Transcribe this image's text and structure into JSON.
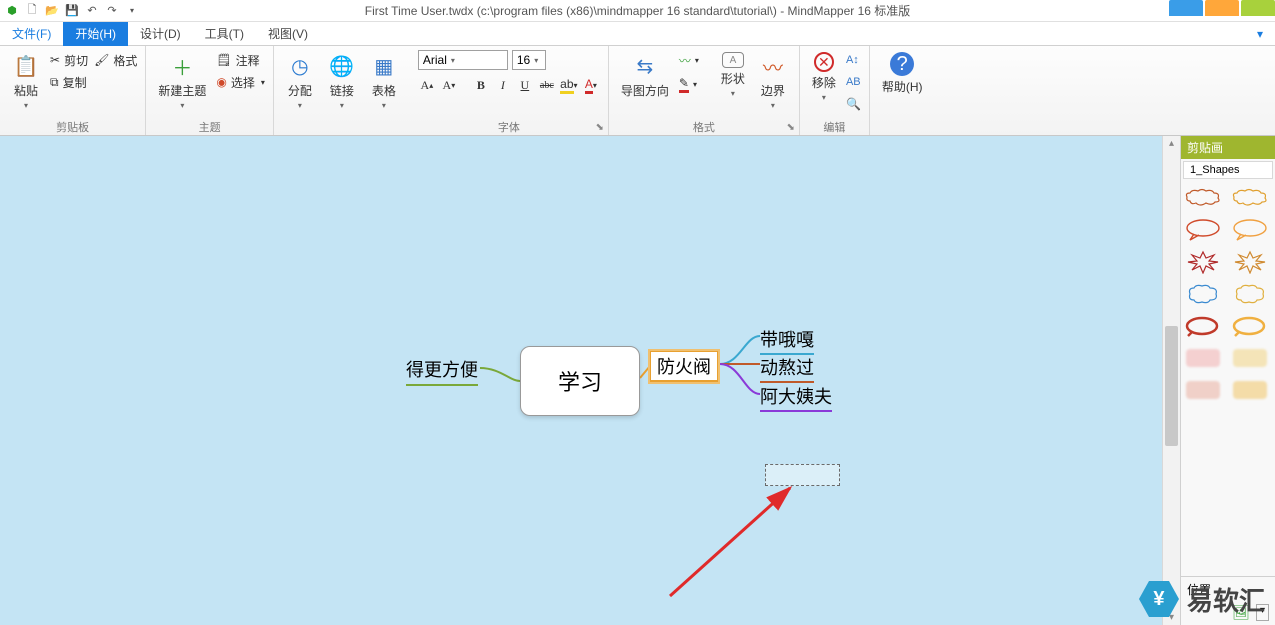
{
  "title": "First Time User.twdx (c:\\program files (x86)\\mindmapper 16 standard\\tutorial\\) - MindMapper 16 标准版",
  "menu": {
    "file": "文件(F)",
    "home": "开始(H)",
    "design": "设计(D)",
    "tools": "工具(T)",
    "view": "视图(V)"
  },
  "ribbon": {
    "clipboard": {
      "paste": "粘贴",
      "cut": "剪切",
      "copy": "复制",
      "format": "格式",
      "label": "剪贴板"
    },
    "topic": {
      "newtopic": "新建主题",
      "note": "注释",
      "select": "选择",
      "label": "主题"
    },
    "assign": "分配",
    "link": "链接",
    "table": "表格",
    "font": {
      "name": "Arial",
      "size": "16",
      "label": "字体"
    },
    "direction": "导图方向",
    "shape": "形状",
    "border": "边界",
    "format_label": "格式",
    "remove": "移除",
    "edit_label": "编辑",
    "help": "帮助(H)"
  },
  "mindmap": {
    "center": "学习",
    "left": "得更方便",
    "selected": "防火阀",
    "r1": "带哦嘎",
    "r2": "动熬过",
    "r3": "阿大姨夫"
  },
  "sidepanel": {
    "header": "剪贴画",
    "tab": "1_Shapes",
    "footer_label": "位置"
  },
  "watermark": "易软汇"
}
